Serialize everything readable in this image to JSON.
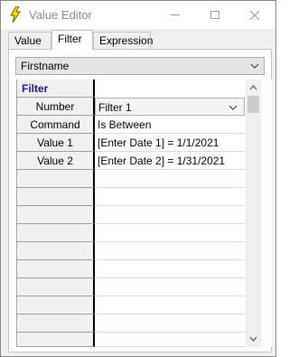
{
  "window": {
    "title": "Value Editor"
  },
  "tabs": [
    {
      "label": "Value",
      "active": false
    },
    {
      "label": "Filter",
      "active": true
    },
    {
      "label": "Expression",
      "active": false
    }
  ],
  "field_select": {
    "value": "Firstname"
  },
  "grid": {
    "header": "Filter",
    "rows": [
      {
        "key": "Number",
        "value": "Filter 1"
      },
      {
        "key": "Command",
        "value": "Is Between"
      },
      {
        "key": "Value 1",
        "value": "[Enter Date 1] = 1/1/2021"
      },
      {
        "key": "Value 2",
        "value": "[Enter Date 2] = 1/31/2021"
      }
    ]
  },
  "colors": {
    "header_text": "#1a1a8a",
    "title_text": "#8c8c8c",
    "icon_bolt": "#f2e600"
  },
  "icons": [
    "lightning-icon",
    "minimize-icon",
    "maximize-icon",
    "close-icon",
    "chevron-down-icon",
    "scroll-up-icon",
    "scroll-down-icon"
  ]
}
